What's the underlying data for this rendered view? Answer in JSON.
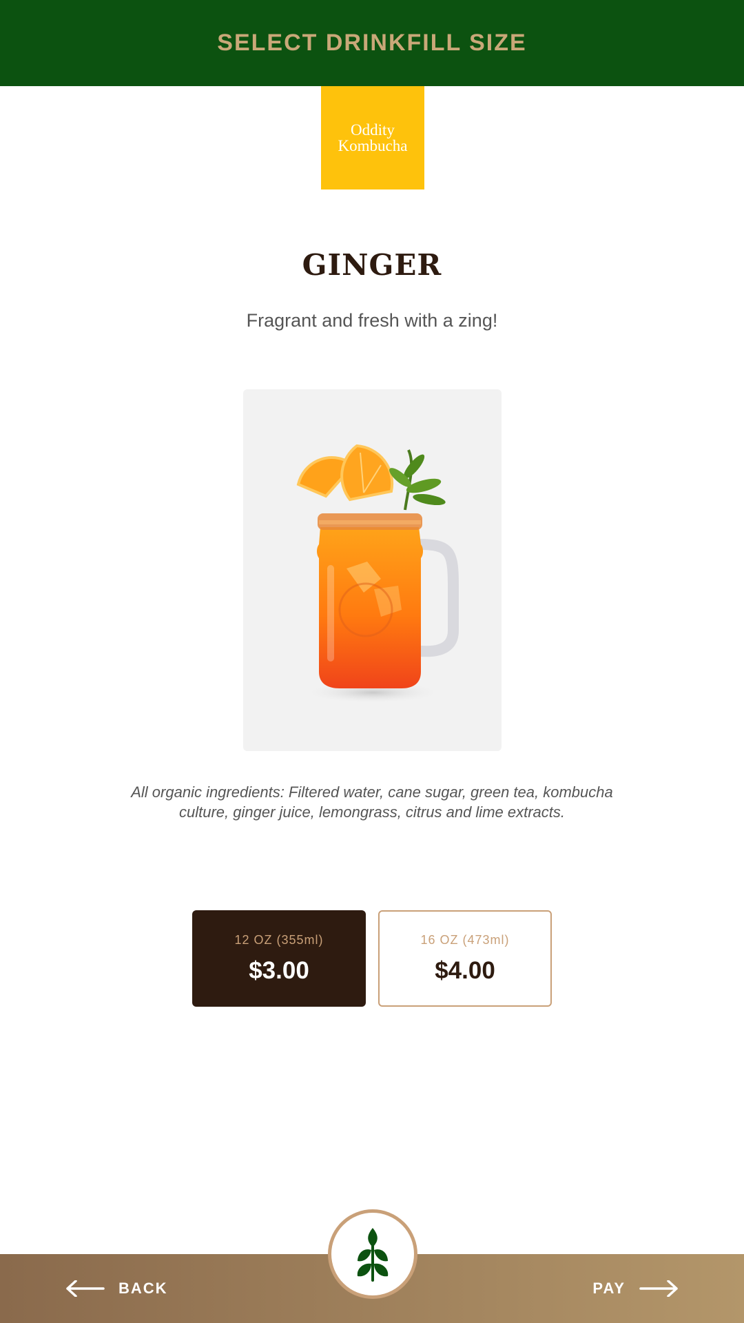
{
  "header": {
    "title": "SELECT DRINKFILL SIZE"
  },
  "logo": {
    "line1": "Oddity",
    "line2": "Kombucha",
    "background": "#fec20c"
  },
  "product": {
    "name": "GINGER",
    "tagline": "Fragrant and fresh with a zing!",
    "ingredients": "All organic ingredients: Filtered water, cane sugar, green tea, kombucha culture, ginger juice, lemongrass, citrus and lime extracts."
  },
  "sizes": [
    {
      "label": "12 OZ (355ml)",
      "price": "$3.00",
      "selected": true
    },
    {
      "label": "16 OZ (473ml)",
      "price": "$4.00",
      "selected": false
    }
  ],
  "footer": {
    "back_label": "BACK",
    "pay_label": "PAY",
    "back_icon": "arrow-left-icon",
    "pay_icon": "arrow-right-icon",
    "badge_icon": "leaf-icon"
  },
  "colors": {
    "header_bg": "#0c5210",
    "header_text": "#c9a878",
    "accent_brown": "#2e1b10",
    "accent_tan": "#c9a078",
    "badge_leaf": "#0c5210"
  }
}
